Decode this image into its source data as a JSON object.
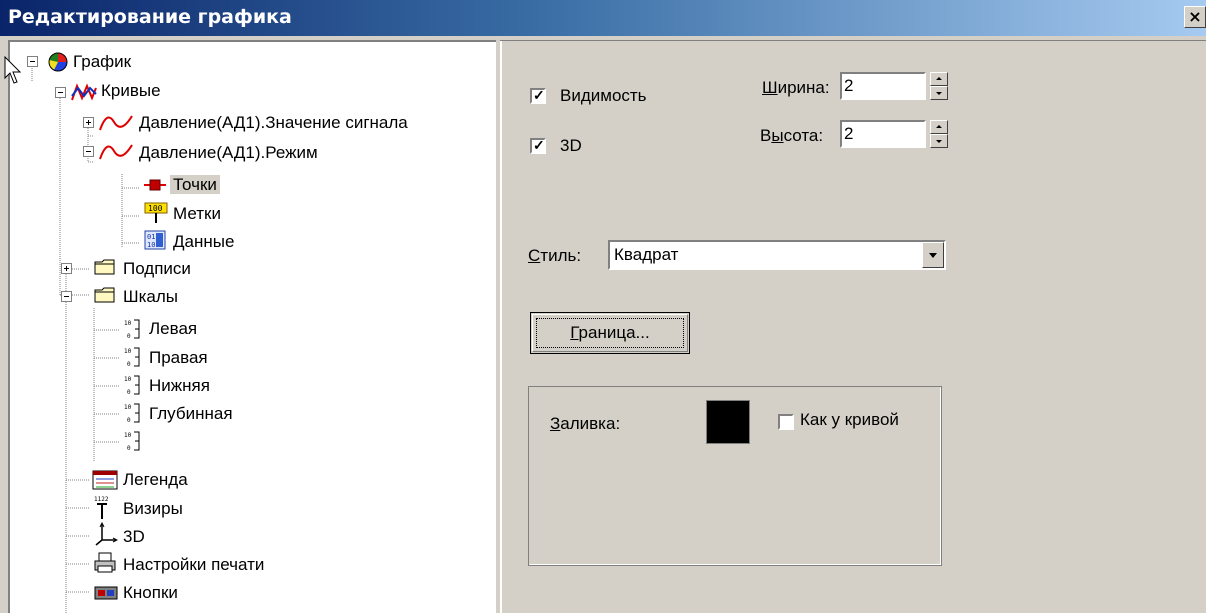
{
  "window": {
    "title": "Редактирование графика",
    "close_glyph": "×"
  },
  "tree": {
    "root": "График",
    "curves": "Кривые",
    "curve1": "Давление(АД1).Значение сигнала",
    "curve2": "Давление(АД1).Режим",
    "points": "Точки",
    "marks": "Метки",
    "data": "Данные",
    "captions": "Подписи",
    "scales": "Шкалы",
    "scale_left": "Левая",
    "scale_right": "Правая",
    "scale_bottom": "Нижняя",
    "scale_depth": "Глубинная",
    "legend": "Легенда",
    "sights": "Визиры",
    "three_d": "3D",
    "print_settings": "Настройки печати",
    "buttons": "Кнопки"
  },
  "props": {
    "visibility_label": "Видимость",
    "visibility_checked": true,
    "three_d_label": "3D",
    "three_d_checked": true,
    "width_label_u": "Ш",
    "width_label_rest": "ирина:",
    "width_value": "2",
    "height_label_a": "В",
    "height_label_u": "ы",
    "height_label_rest": "сота:",
    "height_value": "2",
    "style_label_u": "С",
    "style_label_rest": "тиль:",
    "style_value": "Квадрат",
    "border_button_u": "Г",
    "border_button_rest": "раница...",
    "fill_label_u": "З",
    "fill_label_rest": "аливка:",
    "fill_color": "#000000",
    "like_curve_label": "Как у кривой",
    "like_curve_checked": false
  },
  "colors": {
    "title_start": "#0a246a",
    "title_end": "#a6caf0",
    "face": "#d4d0c8",
    "curve_red": "#e00000"
  }
}
